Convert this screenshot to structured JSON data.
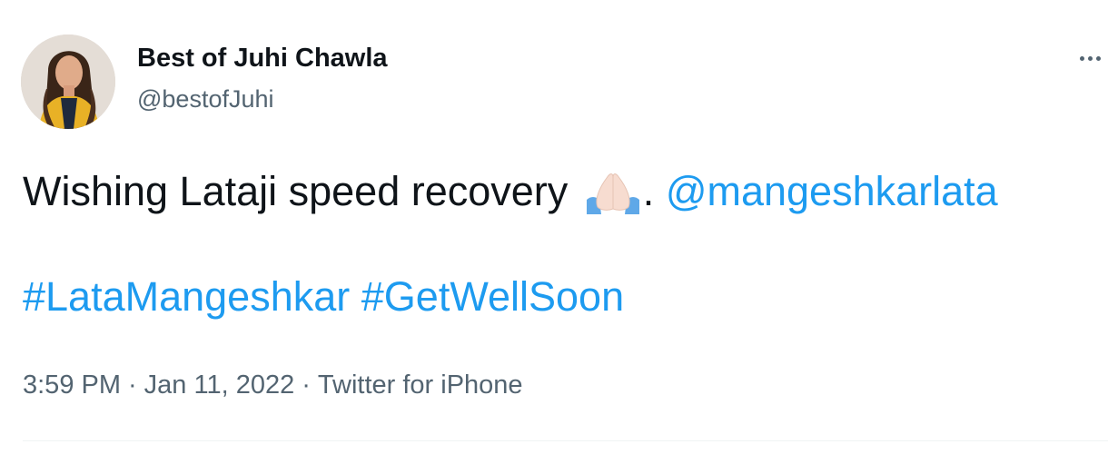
{
  "author": {
    "display_name": "Best of Juhi Chawla",
    "handle": "@bestofJuhi"
  },
  "tweet": {
    "line1_text": "Wishing Lataji speed recovery ",
    "line1_emoji": "folded-hands-emoji",
    "line1_punct": ". ",
    "mention": "@mangeshkarlata",
    "hashtags": [
      "#LataMangeshkar",
      "#GetWellSoon"
    ]
  },
  "meta": {
    "time": "3:59 PM",
    "date": "Jan 11, 2022",
    "source": "Twitter for iPhone",
    "separator": "·"
  },
  "colors": {
    "link": "#1d9bf0",
    "text": "#0f1419",
    "secondary": "#536471"
  }
}
